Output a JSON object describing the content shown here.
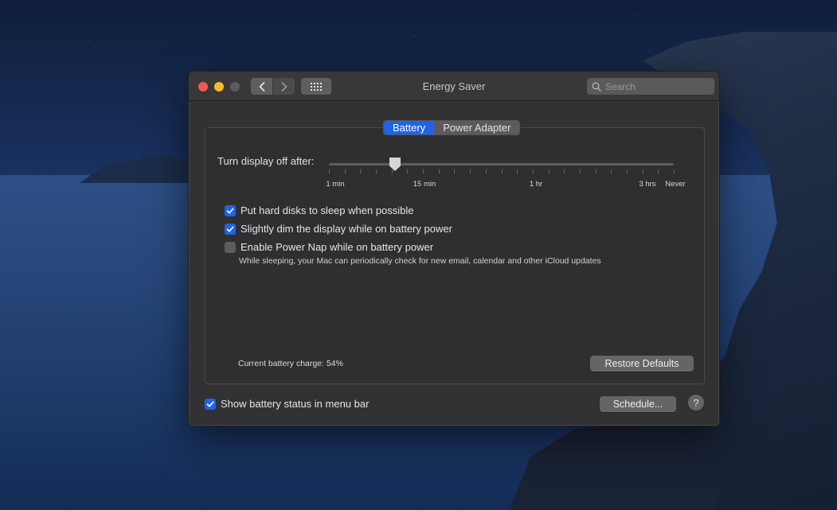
{
  "window": {
    "title": "Energy Saver",
    "search_placeholder": "Search"
  },
  "tabs": [
    {
      "label": "Battery",
      "active": true
    },
    {
      "label": "Power Adapter",
      "active": false
    }
  ],
  "slider": {
    "label": "Turn display off after:",
    "ticks": [
      "1 min",
      "15 min",
      "1 hr",
      "3 hrs",
      "Never"
    ],
    "selected_value": "15 min"
  },
  "options": [
    {
      "label": "Put hard disks to sleep when possible",
      "checked": true
    },
    {
      "label": "Slightly dim the display while on battery power",
      "checked": true
    },
    {
      "label": "Enable Power Nap while on battery power",
      "checked": false,
      "description": "While sleeping, your Mac can periodically check for new email, calendar and other iCloud updates"
    }
  ],
  "battery_charge": "Current battery charge: 54%",
  "restore_defaults_label": "Restore Defaults",
  "show_status": {
    "label": "Show battery status in menu bar",
    "checked": true
  },
  "schedule_label": "Schedule...",
  "help_label": "?",
  "colors": {
    "accent": "#1f63e6",
    "window_bg": "#323234"
  }
}
